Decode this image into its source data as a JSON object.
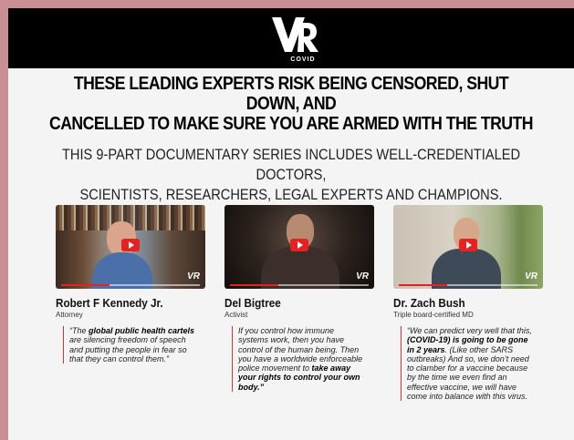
{
  "header": {
    "logo_text": "VR",
    "logo_subtext": "COVID"
  },
  "headline": {
    "line1": "THESE LEADING EXPERTS RISK BEING CENSORED, SHUT DOWN, AND",
    "line2": "CANCELLED TO MAKE SURE YOU ARE ARMED WITH THE TRUTH"
  },
  "subhead": {
    "line1": "THIS 9-PART DOCUMENTARY SERIES INCLUDES WELL-CREDENTIALED DOCTORS,",
    "line2": "SCIENTISTS, RESEARCHERS, LEGAL EXPERTS AND CHAMPIONS."
  },
  "experts": [
    {
      "name": "Robert F Kennedy Jr.",
      "role": "Attorney",
      "video_watermark": "VR",
      "quote": [
        {
          "t": "“The ",
          "b": false
        },
        {
          "t": "global public health cartels",
          "b": true
        },
        {
          "t": " are silencing freedom of speech and putting the people in fear so that they can control them.”",
          "b": false
        }
      ]
    },
    {
      "name": "Del Bigtree",
      "role": "Activist",
      "video_watermark": "VR",
      "quote": [
        {
          "t": "If you control how immune systems work, then you have control of the human being. Then you have a worldwide enforceable police movement to ",
          "b": false
        },
        {
          "t": "take away your rights to control your own body.”",
          "b": true
        }
      ]
    },
    {
      "name": "Dr. Zach Bush",
      "role": "Triple board-certified MD",
      "video_watermark": "VR",
      "quote": [
        {
          "t": "“We can predict very well that this, ",
          "b": false
        },
        {
          "t": "(COVID-19) is going to be gone in 2 years",
          "b": true
        },
        {
          "t": ". (Like other SARS outbreaks) And so, we don’t need to clamber for a vaccine because by the time we even find an effective vaccine, we will have come into balance with this virus.",
          "b": false
        }
      ]
    }
  ],
  "colors": {
    "border": "#c98f93",
    "play_button": "#e52222",
    "quote_rule": "#dd3333"
  }
}
